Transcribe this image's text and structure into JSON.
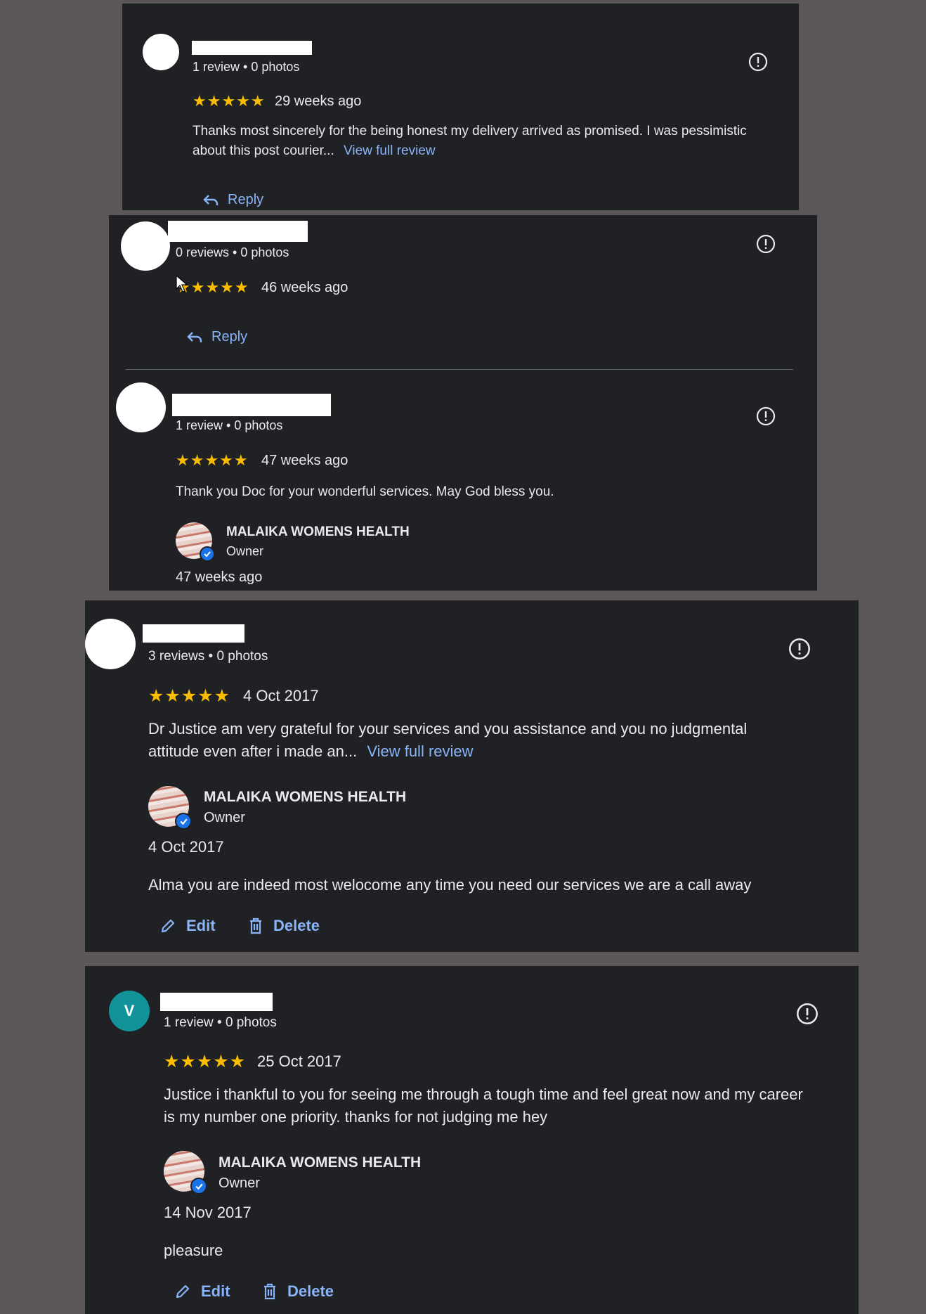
{
  "reviews": [
    {
      "meta": "1 review • 0 photos",
      "stars": "★★★★★",
      "time": "29 weeks ago",
      "text": "Thanks most sincerely for the being honest my delivery arrived as promised. I was pessimistic about this post courier...",
      "link": "View full review",
      "reply_label": "Reply"
    },
    {
      "meta": "0 reviews • 0 photos",
      "stars": "★★★★★",
      "time": "46 weeks ago",
      "reply_label": "Reply"
    },
    {
      "meta": "1 review • 0 photos",
      "stars": "★★★★★",
      "time": "47 weeks ago",
      "text": "Thank you Doc for your wonderful services. May God bless you.",
      "owner": {
        "name": "MALAIKA WOMENS HEALTH",
        "role": "Owner",
        "time": "47 weeks ago"
      }
    },
    {
      "meta": "3 reviews • 0 photos",
      "stars": "★★★★★",
      "time": "4 Oct 2017",
      "text": "Dr Justice am very grateful for your services and you assistance and you no judgmental attitude even after i made an...",
      "link": "View full review",
      "owner": {
        "name": "MALAIKA WOMENS HEALTH",
        "role": "Owner",
        "time": "4 Oct 2017",
        "response": "Alma you are indeed most welocome any time you need our services we are a call away"
      },
      "edit_label": "Edit",
      "delete_label": "Delete"
    },
    {
      "avatar_letter": "V",
      "meta": "1 review • 0 photos",
      "stars": "★★★★★",
      "time": "25 Oct 2017",
      "text": "Justice i thankful to you for seeing me through a tough time and feel great now and my career is my number one priority. thanks for not judging me hey",
      "owner": {
        "name": "MALAIKA WOMENS HEALTH",
        "role": "Owner",
        "time": "14 Nov 2017",
        "response": "pleasure"
      },
      "edit_label": "Edit",
      "delete_label": "Delete"
    }
  ],
  "colors": {
    "background": "#5b5758",
    "panel": "#202124",
    "star": "#fbbc04",
    "link": "#8ab4f8",
    "verified": "#1a73e8",
    "avatar_teal": "#12939a"
  }
}
